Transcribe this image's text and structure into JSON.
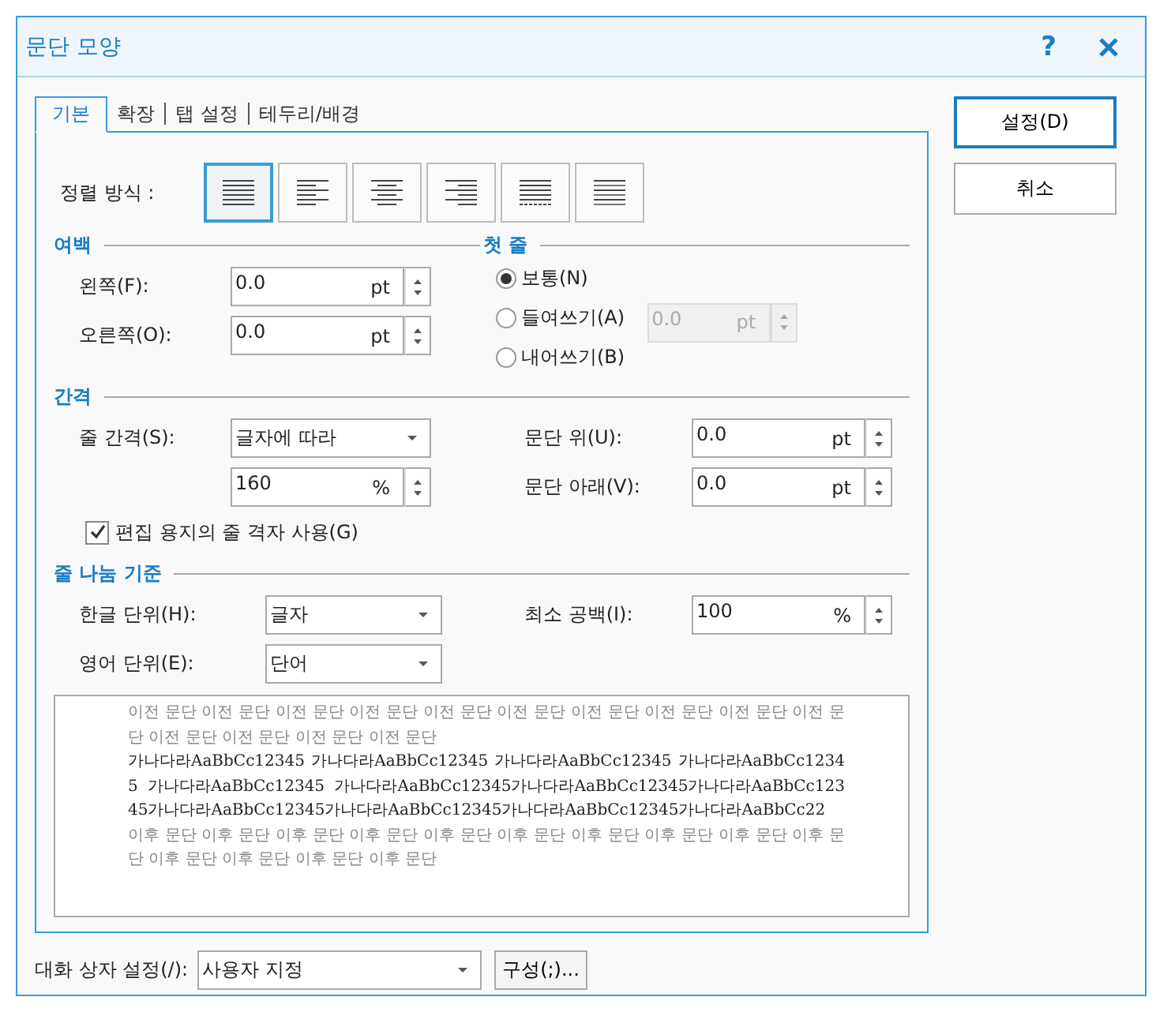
{
  "window": {
    "title": "문단 모양",
    "help": "?"
  },
  "tabs": [
    {
      "label": "기본",
      "selected": true
    },
    {
      "label": "확장",
      "selected": false
    },
    {
      "label": "탭 설정",
      "selected": false
    },
    {
      "label": "테두리/배경",
      "selected": false
    }
  ],
  "alignment": {
    "label": "정렬 방식 :",
    "options": [
      {
        "kind": "justify",
        "selected": true
      },
      {
        "kind": "left",
        "selected": false
      },
      {
        "kind": "center",
        "selected": false
      },
      {
        "kind": "right",
        "selected": false
      },
      {
        "kind": "distribute",
        "selected": false
      },
      {
        "kind": "divide",
        "selected": false
      }
    ]
  },
  "margin": {
    "title": "여백",
    "fields": [
      {
        "label": "왼쪽(F):",
        "value": "0.0",
        "unit": "pt"
      },
      {
        "label": "오른쪽(O):",
        "value": "0.0",
        "unit": "pt"
      }
    ]
  },
  "first_line": {
    "title": "첫 줄",
    "options": [
      {
        "label": "보통(N)",
        "selected": true
      },
      {
        "label": "들여쓰기(A)",
        "selected": false
      },
      {
        "label": "내어쓰기(B)",
        "selected": false
      }
    ],
    "field": {
      "value": "0.0",
      "unit": "pt",
      "disabled": true
    }
  },
  "spacing": {
    "title": "간격",
    "line_spacing": {
      "label": "줄 간격(S):",
      "value": "글자에 따라"
    },
    "line_value": {
      "value": "160",
      "unit": "%"
    },
    "before": {
      "label": "문단 위(U):",
      "value": "0.0",
      "unit": "pt"
    },
    "after": {
      "label": "문단 아래(V):",
      "value": "0.0",
      "unit": "pt"
    },
    "grid_checkbox": {
      "label": "편집 용지의 줄 격자 사용(G)",
      "checked": true
    }
  },
  "line_break": {
    "title": "줄 나눔 기준",
    "hangul": {
      "label": "한글 단위(H):",
      "value": "글자"
    },
    "english": {
      "label": "영어 단위(E):",
      "value": "단어"
    },
    "min_space": {
      "label": "최소 공백(I):",
      "value": "100",
      "unit": "%"
    }
  },
  "preview": {
    "before": "이전 문단 이전 문단 이전 문단 이전 문단 이전 문단 이전 문단 이전 문단 이전 문단 이전 문단 이전 문단 이전 문단 이전 문단 이전 문단 이전 문단",
    "current": "가나다라AaBbCc12345 가나다라AaBbCc12345 가나다라AaBbCc12345 가나다라AaBbCc12345 가나다라AaBbCc12345 가나다라AaBbCc12345가나다라AaBbCc12345가나다라AaBbCc12345가나다라AaBbCc12345가나다라AaBbCc12345가나다라AaBbCc12345가나다라AaBbCc22",
    "after": "이후 문단 이후 문단 이후 문단 이후 문단 이후 문단 이후 문단 이후 문단 이후 문단 이후 문단 이후 문단 이후 문단 이후 문단 이후 문단 이후 문단"
  },
  "footer": {
    "label": "대화 상자 설정(/):",
    "value": "사용자 지정",
    "button": "구성(;)..."
  },
  "buttons": [
    {
      "label": "설정(D)",
      "default": true
    },
    {
      "label": "취소",
      "default": false
    }
  ]
}
